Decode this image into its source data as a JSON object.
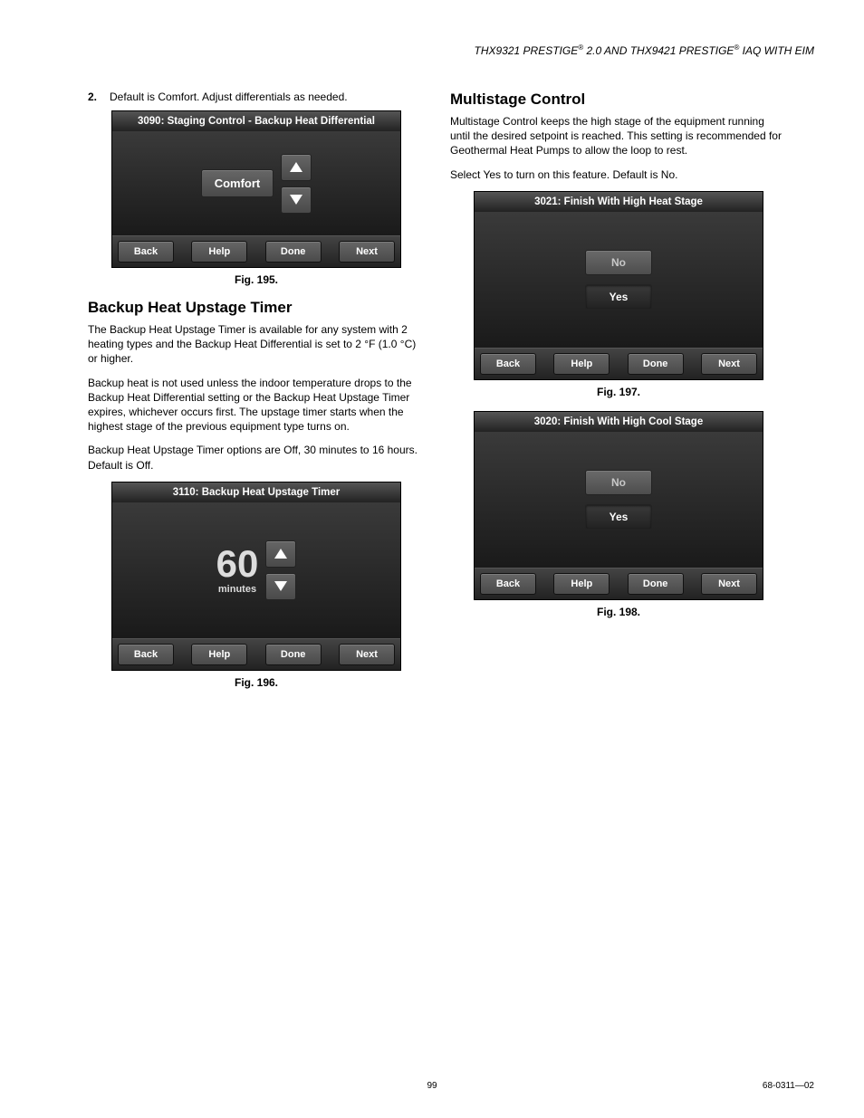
{
  "header": {
    "text_1": "THX9321 PRESTIGE",
    "sup_1": "®",
    "text_2": " 2.0 AND THX9421 PRESTIGE",
    "sup_2": "®",
    "text_3": " IAQ WITH EIM"
  },
  "left": {
    "step_num": "2.",
    "step_text": "Default is Comfort. Adjust differentials as needed.",
    "fig195": {
      "title": "3090: Staging Control - Backup Heat Differential",
      "value": "Comfort",
      "nav": {
        "back": "Back",
        "help": "Help",
        "done": "Done",
        "next": "Next"
      },
      "caption": "Fig. 195."
    },
    "heading": "Backup Heat Upstage Timer",
    "para1": "The Backup Heat Upstage Timer is available for any system with 2 heating types and the Backup Heat Differential is set to 2 °F (1.0 °C) or higher.",
    "para2": "Backup heat is not used unless the indoor temperature drops to the Backup Heat Differential setting or the Backup Heat Upstage Timer expires, whichever occurs first. The upstage timer starts when the highest stage of the previous equipment type turns on.",
    "para3": "Backup Heat Upstage Timer options are Off, 30 minutes to 16 hours. Default is Off.",
    "fig196": {
      "title": "3110: Backup Heat Upstage Timer",
      "value": "60",
      "unit": "minutes",
      "nav": {
        "back": "Back",
        "help": "Help",
        "done": "Done",
        "next": "Next"
      },
      "caption": "Fig. 196."
    }
  },
  "right": {
    "heading": "Multistage Control",
    "para1": "Multistage Control keeps the high stage of the equipment running until the desired setpoint is reached. This setting is recommended for Geothermal Heat Pumps to allow the loop to rest.",
    "para2": "Select Yes to turn on this feature. Default is No.",
    "fig197": {
      "title": "3021: Finish With High Heat Stage",
      "opt_no": "No",
      "opt_yes": "Yes",
      "nav": {
        "back": "Back",
        "help": "Help",
        "done": "Done",
        "next": "Next"
      },
      "caption": "Fig. 197."
    },
    "fig198": {
      "title": "3020: Finish With High Cool Stage",
      "opt_no": "No",
      "opt_yes": "Yes",
      "nav": {
        "back": "Back",
        "help": "Help",
        "done": "Done",
        "next": "Next"
      },
      "caption": "Fig. 198."
    }
  },
  "footer": {
    "page": "99",
    "docnum": "68-0311—02"
  }
}
